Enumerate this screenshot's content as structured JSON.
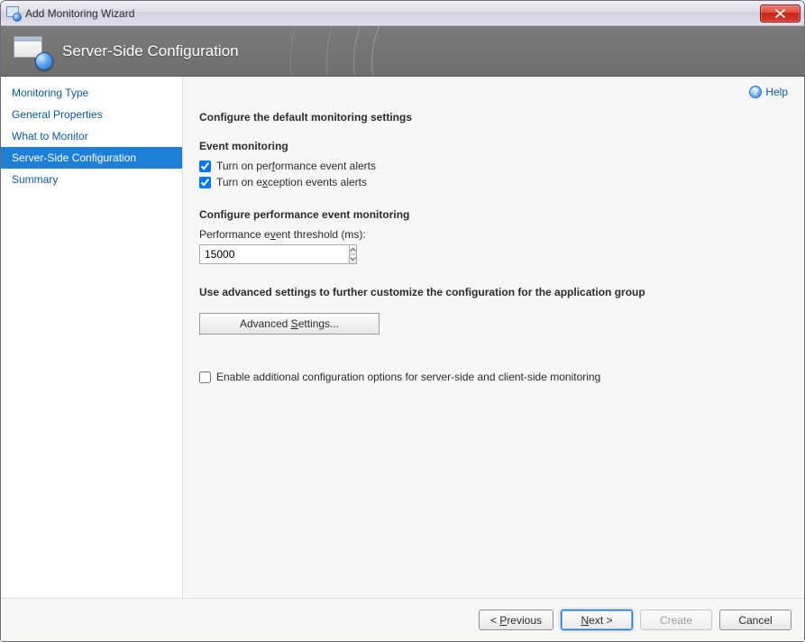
{
  "window": {
    "title": "Add Monitoring Wizard"
  },
  "banner": {
    "title": "Server-Side Configuration"
  },
  "help": {
    "label": "Help"
  },
  "sidebar": {
    "items": [
      {
        "label": "Monitoring Type",
        "active": false
      },
      {
        "label": "General Properties",
        "active": false
      },
      {
        "label": "What to Monitor",
        "active": false
      },
      {
        "label": "Server-Side Configuration",
        "active": true
      },
      {
        "label": "Summary",
        "active": false
      }
    ]
  },
  "content": {
    "heading": "Configure the default monitoring settings",
    "event_monitoring": {
      "title": "Event monitoring",
      "perf_alerts": {
        "label_pre": "Turn on per",
        "label_u": "f",
        "label_post": "ormance event alerts",
        "checked": true
      },
      "exc_alerts": {
        "label_pre": "Turn on e",
        "label_u": "x",
        "label_post": "ception events alerts",
        "checked": true
      }
    },
    "perf_config": {
      "title": "Configure performance event monitoring",
      "threshold_label_pre": "Performance e",
      "threshold_label_u": "v",
      "threshold_label_post": "ent threshold (ms):",
      "threshold_value": "15000"
    },
    "advanced": {
      "title": "Use advanced settings to further customize the configuration for the application group",
      "button_pre": "Advanced ",
      "button_u": "S",
      "button_post": "ettings..."
    },
    "enable_additional": {
      "label": "Enable additional configuration options for server-side and client-side monitoring",
      "checked": false
    }
  },
  "footer": {
    "previous_pre": "< ",
    "previous_u": "P",
    "previous_post": "revious",
    "next_pre": "",
    "next_u": "N",
    "next_post": "ext >",
    "create_label": "Create",
    "cancel_label": "Cancel"
  }
}
